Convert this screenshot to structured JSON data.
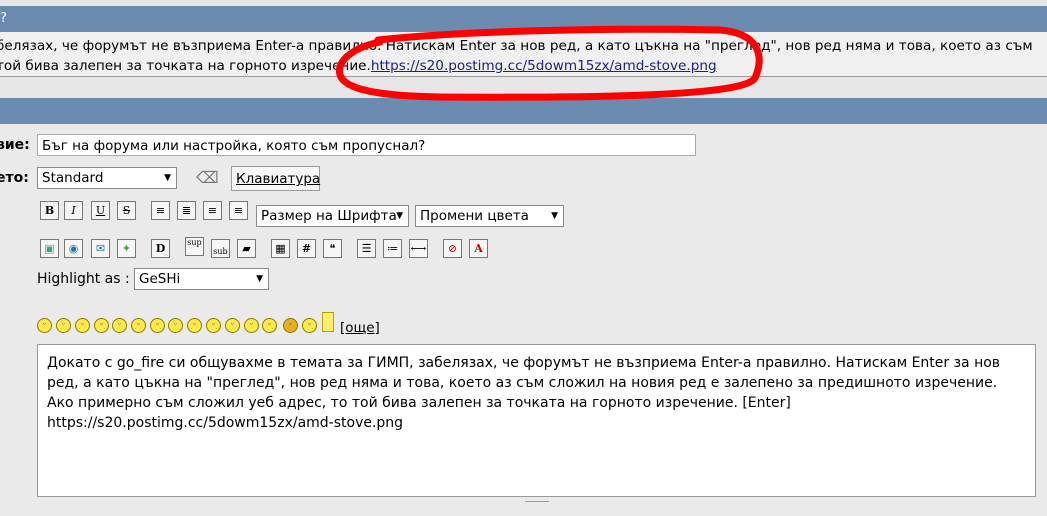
{
  "header": {
    "title": "?"
  },
  "preview": {
    "line1": "белязах, че форумът не възприема Enter-а правилно. Натискам Enter за нов ред, а като цъкна на \"преглед\", нов ред няма и това, което аз съм",
    "line2_prefix": "той бива залепен за точката на горното изречение.",
    "line2_link": "https://s20.postimg.cc/5dowm15zx/amd-stove.png"
  },
  "form": {
    "subject_label": "вие:",
    "subject_value": "Бъг на форума или настройка, която съм пропуснал?",
    "layout_label": "ето:",
    "layout_value": "Standard",
    "keyboard_label": "Клавиатура",
    "font_size_label": "Размер на Шрифта",
    "color_label": "Промени цвета",
    "highlight_label": "Highlight as :",
    "highlight_value": "GeSHi",
    "more_smilies": "[още]",
    "message": "Докато с go_fire си общувахме в темата за ГИМП, забелязах, че форумът не възприема Enter-а правилно. Натискам Enter за нов ред, а като цъкна на \"преглед\", нов ред няма и това, което аз съм сложил на новия ред е залепено за предишното изречение. Ако примерно съм сложил уеб адрес, то той бива залепен за точката на горното изречение. [Enter]\nhttps://s20.postimg.cc/5dowm15zx/amd-stove.png"
  },
  "toolbar": {
    "bold": "B",
    "italic": "I",
    "underline": "U",
    "strike": "S",
    "sup": "sup",
    "sub": "sub",
    "hash": "#"
  },
  "colors": {
    "header": "#6b8bb1",
    "annotation": "#ff0000",
    "link": "#1a237e"
  }
}
